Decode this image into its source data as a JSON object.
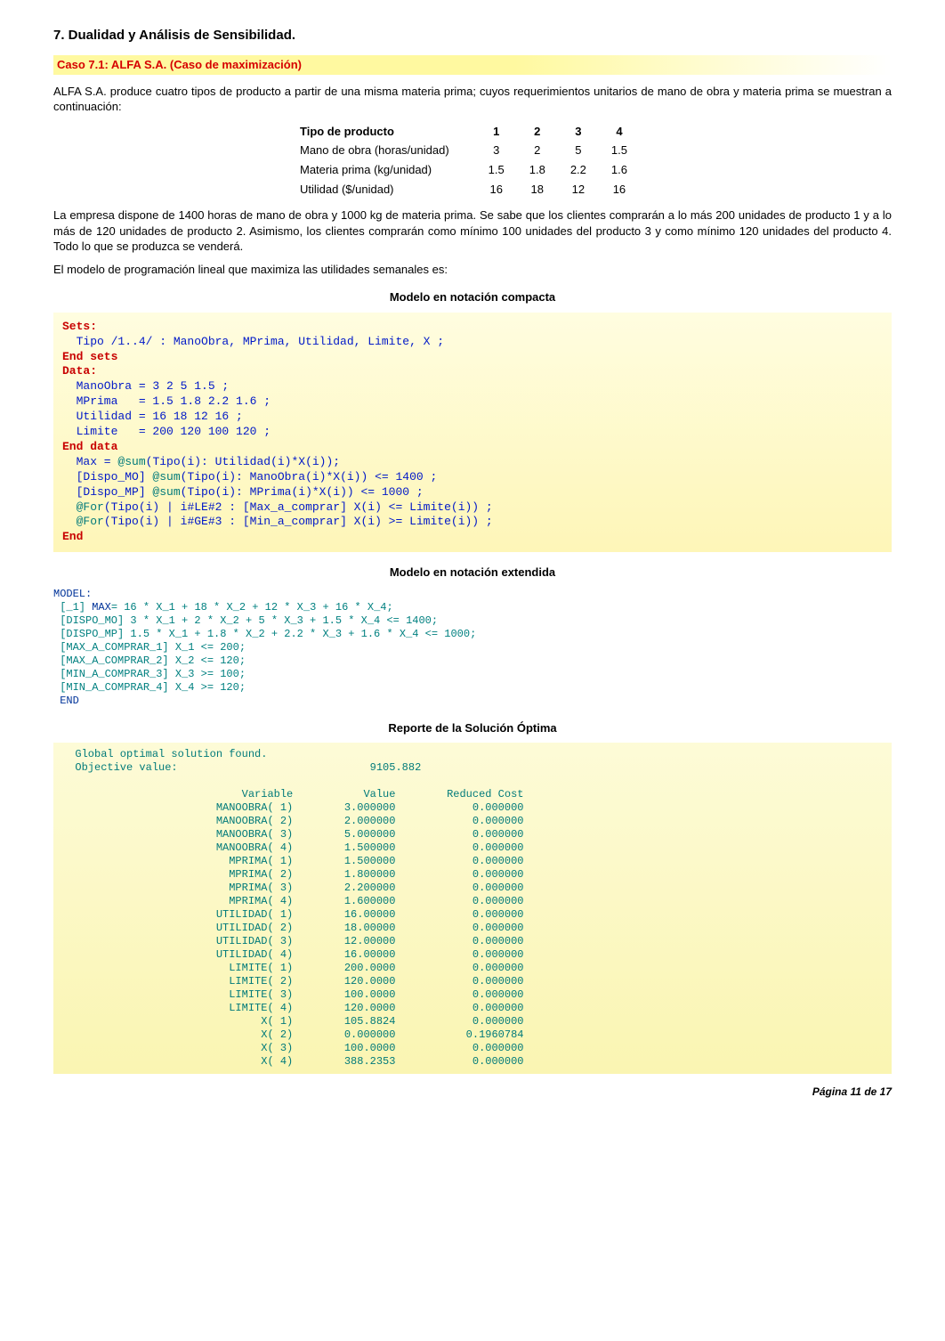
{
  "section_title": "7.   Dualidad y Análisis de Sensibilidad.",
  "case_title": "Caso 7.1: ALFA S.A. (Caso de maximización)",
  "intro_p1": "ALFA S.A. produce cuatro tipos de producto a partir de una misma materia prima; cuyos requerimientos unitarios de mano de obra y materia prima se muestran a continuación:",
  "table": {
    "head": [
      "Tipo de producto",
      "1",
      "2",
      "3",
      "4"
    ],
    "rows": [
      [
        "Mano de obra (horas/unidad)",
        "3",
        "2",
        "5",
        "1.5"
      ],
      [
        "Materia prima (kg/unidad)",
        "1.5",
        "1.8",
        "2.2",
        "1.6"
      ],
      [
        "Utilidad ($/unidad)",
        "16",
        "18",
        "12",
        "16"
      ]
    ]
  },
  "intro_p2": "La empresa dispone de 1400 horas de mano de obra y 1000 kg de materia prima. Se sabe que los clientes comprarán a lo más 200 unidades de producto 1 y a lo más de 120 unidades de producto 2. Asimismo, los clientes comprarán como mínimo 100 unidades del producto 3 y como mínimo 120 unidades del producto 4. Todo lo que se produzca se venderá.",
  "intro_p3": "El modelo de programación lineal que maximiza las utilidades semanales es:",
  "head_compact": "Modelo en notación compacta",
  "compact": {
    "sets": "Sets:",
    "l1": "  Tipo /1..4/ : ManoObra, MPrima, Utilidad, Limite, X ;",
    "endsets": "End sets",
    "data": "Data:",
    "d1": "  ManoObra = 3 2 5 1.5 ;",
    "d2": "  MPrima   = 1.5 1.8 2.2 1.6 ;",
    "d3": "  Utilidad = 16 18 12 16 ;",
    "d4": "  Limite   = 200 120 100 120 ;",
    "enddata": "End data",
    "m1a": "  Max = ",
    "m1b": "@sum",
    "m1c": "(Tipo(i): Utilidad(i)*X(i));",
    "m2a": "  [Dispo_MO] ",
    "m2b": "@sum",
    "m2c": "(Tipo(i): ManoObra(i)*X(i)) <= 1400 ;",
    "m3a": "  [Dispo_MP] ",
    "m3b": "@sum",
    "m3c": "(Tipo(i): MPrima(i)*X(i)) <= 1000 ;",
    "m4a": "  ",
    "m4b": "@For",
    "m4c": "(Tipo(i) | i#LE#2 : [Max_a_comprar] X(i) <= Limite(i)) ;",
    "m5a": "  ",
    "m5b": "@For",
    "m5c": "(Tipo(i) | i#GE#3 : [Min_a_comprar] X(i) >= Limite(i)) ;",
    "end": "End"
  },
  "head_ext": "Modelo en notación extendida",
  "ext": {
    "model": "MODEL:",
    "l1a": " [_1] ",
    "l1b": "MAX",
    "l1c": "= 16 * X_1 + 18 * X_2 + 12 * X_3 + 16 * X_4;",
    "l2": " [DISPO_MO] 3 * X_1 + 2 * X_2 + 5 * X_3 + 1.5 * X_4 <= 1400;",
    "l3": " [DISPO_MP] 1.5 * X_1 + 1.8 * X_2 + 2.2 * X_3 + 1.6 * X_4 <= 1000;",
    "l4": " [MAX_A_COMPRAR_1] X_1 <= 200;",
    "l5": " [MAX_A_COMPRAR_2] X_2 <= 120;",
    "l6": " [MIN_A_COMPRAR_3] X_3 >= 100;",
    "l7": " [MIN_A_COMPRAR_4] X_4 >= 120;",
    "end": " END"
  },
  "head_report": "Reporte de la Solución Óptima",
  "report": {
    "h1": "  Global optimal solution found.",
    "h2": "  Objective value:                              9105.882",
    "colhead": "                            Variable           Value        Reduced Cost",
    "rows": [
      "                        MANOOBRA( 1)        3.000000            0.000000",
      "                        MANOOBRA( 2)        2.000000            0.000000",
      "                        MANOOBRA( 3)        5.000000            0.000000",
      "                        MANOOBRA( 4)        1.500000            0.000000",
      "                          MPRIMA( 1)        1.500000            0.000000",
      "                          MPRIMA( 2)        1.800000            0.000000",
      "                          MPRIMA( 3)        2.200000            0.000000",
      "                          MPRIMA( 4)        1.600000            0.000000",
      "                        UTILIDAD( 1)        16.00000            0.000000",
      "                        UTILIDAD( 2)        18.00000            0.000000",
      "                        UTILIDAD( 3)        12.00000            0.000000",
      "                        UTILIDAD( 4)        16.00000            0.000000",
      "                          LIMITE( 1)        200.0000            0.000000",
      "                          LIMITE( 2)        120.0000            0.000000",
      "                          LIMITE( 3)        100.0000            0.000000",
      "                          LIMITE( 4)        120.0000            0.000000",
      "                               X( 1)        105.8824            0.000000",
      "                               X( 2)        0.000000           0.1960784",
      "                               X( 3)        100.0000            0.000000",
      "                               X( 4)        388.2353            0.000000"
    ]
  },
  "footer": "Página 11 de 17"
}
